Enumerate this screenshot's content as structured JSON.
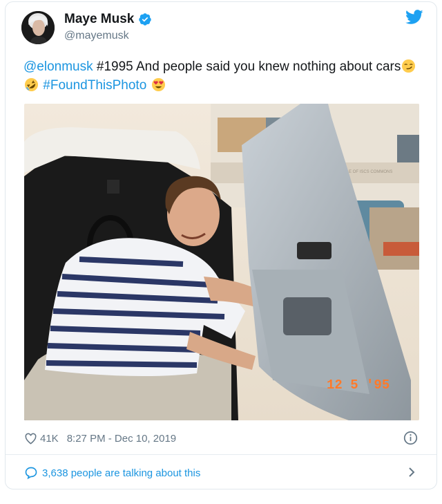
{
  "author": {
    "display_name": "Maye Musk",
    "handle": "@mayemusk",
    "verified": true
  },
  "tweet": {
    "mention": "@elonmusk",
    "text_part1": " #1995 And people said you knew nothing about cars",
    "hashtag": "#FoundThisPhoto",
    "emojis": [
      "smirking-face",
      "rolling-on-floor-laughing",
      "heart-eyes"
    ]
  },
  "photo": {
    "date_stamp": "12  5 '95",
    "sign_text": "E OF ISCS COMMONS"
  },
  "meta": {
    "like_count": "41K",
    "timestamp": "8:27 PM - Dec 10, 2019"
  },
  "footer": {
    "talking_text": "3,638 people are talking about this"
  },
  "colors": {
    "link": "#1b95e0",
    "verified": "#1da1f2",
    "muted": "#657786",
    "border": "#e1e8ed"
  }
}
